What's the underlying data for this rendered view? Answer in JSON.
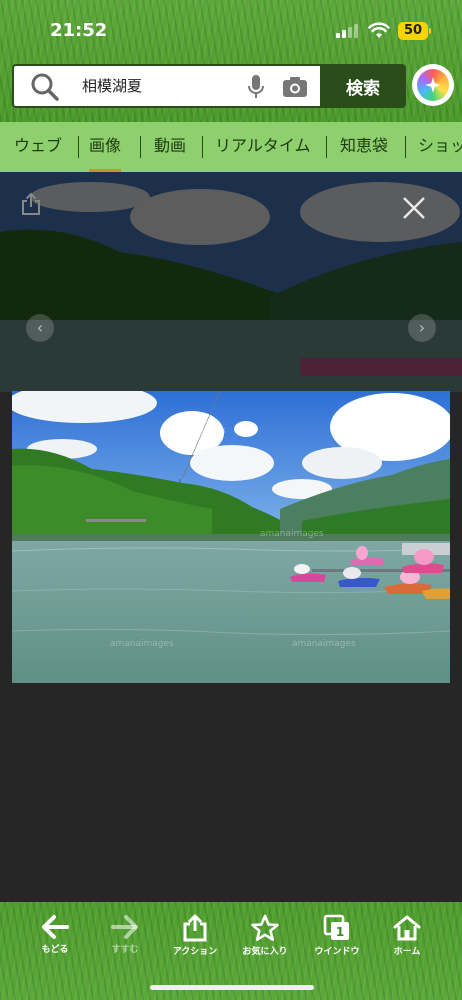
{
  "status": {
    "time": "21:52",
    "battery": "50"
  },
  "search": {
    "query": "相模湖夏",
    "button_label": "検索"
  },
  "tabs": [
    {
      "label": "ウェブ"
    },
    {
      "label": "画像"
    },
    {
      "label": "動画"
    },
    {
      "label": "リアルタイム"
    },
    {
      "label": "知恵袋"
    },
    {
      "label": "ショッ"
    }
  ],
  "active_tab": "画像",
  "viewer": {
    "watermark": "amanaimages"
  },
  "bottom_nav": [
    {
      "label": "もどる",
      "icon": "back-arrow-icon"
    },
    {
      "label": "すすむ",
      "icon": "forward-arrow-icon"
    },
    {
      "label": "アクション",
      "icon": "share-icon"
    },
    {
      "label": "お気に入り",
      "icon": "star-icon"
    },
    {
      "label": "ウインドウ",
      "icon": "windows-icon",
      "badge": "1"
    },
    {
      "label": "ホーム",
      "icon": "home-icon"
    }
  ],
  "colors": {
    "tab_bar": "#8fd06e",
    "search_button": "#2b4d1a",
    "active_tab_underline": "#d98d2a",
    "battery": "#f5d400"
  }
}
